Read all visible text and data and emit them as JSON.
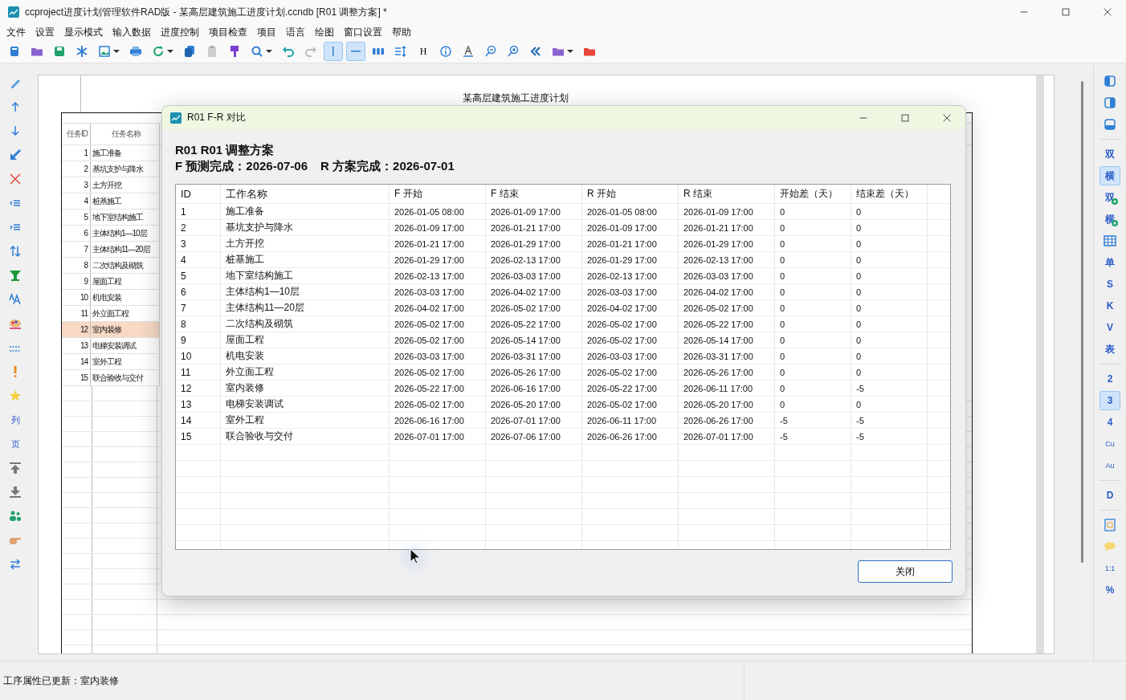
{
  "window": {
    "title": "ccproject进度计划管理软件RAD版 - 某高层建筑施工进度计划.ccndb [R01 调整方案] *"
  },
  "menu": [
    "文件",
    "设置",
    "显示模式",
    "输入数据",
    "进度控制",
    "项目检查",
    "项目",
    "语言",
    "绘图",
    "窗口设置",
    "帮助"
  ],
  "toolbar": [
    {
      "kind": "icon",
      "selected": false,
      "dropdown": false
    },
    {
      "kind": "icon",
      "selected": false,
      "dropdown": false
    },
    {
      "kind": "icon",
      "selected": false,
      "dropdown": false
    },
    {
      "kind": "icon",
      "selected": false,
      "dropdown": false
    },
    {
      "kind": "icon",
      "selected": false,
      "dropdown": true
    },
    {
      "kind": "icon",
      "selected": false,
      "dropdown": false
    },
    {
      "kind": "icon",
      "selected": false,
      "dropdown": true
    },
    {
      "kind": "icon",
      "selected": false,
      "dropdown": false
    },
    {
      "kind": "icon",
      "selected": false,
      "dropdown": false
    },
    {
      "kind": "icon",
      "selected": false,
      "dropdown": false
    },
    {
      "kind": "icon",
      "selected": false,
      "dropdown": true
    },
    {
      "kind": "icon",
      "selected": false,
      "dropdown": false
    },
    {
      "kind": "icon",
      "selected": false,
      "dropdown": false
    },
    {
      "kind": "icon",
      "selected": true,
      "dropdown": false
    },
    {
      "kind": "icon",
      "selected": true,
      "dropdown": false
    },
    {
      "kind": "icon",
      "selected": false,
      "dropdown": false
    },
    {
      "kind": "icon",
      "selected": false,
      "dropdown": false
    },
    {
      "kind": "text",
      "label": "H",
      "selected": false,
      "dropdown": false
    },
    {
      "kind": "icon",
      "selected": false,
      "dropdown": false
    },
    {
      "kind": "icon",
      "selected": false,
      "dropdown": false
    },
    {
      "kind": "icon",
      "selected": false,
      "dropdown": false
    },
    {
      "kind": "icon",
      "selected": false,
      "dropdown": false
    },
    {
      "kind": "icon",
      "selected": false,
      "dropdown": false
    },
    {
      "kind": "icon",
      "selected": false,
      "dropdown": true
    },
    {
      "kind": "icon",
      "selected": false,
      "dropdown": false
    }
  ],
  "left_toolbar": [
    {
      "kind": "icon"
    },
    {
      "kind": "icon"
    },
    {
      "kind": "icon"
    },
    {
      "kind": "icon"
    },
    {
      "kind": "icon"
    },
    {
      "kind": "icon"
    },
    {
      "kind": "icon"
    },
    {
      "kind": "icon"
    },
    {
      "kind": "icon"
    },
    {
      "kind": "icon"
    },
    {
      "kind": "icon"
    },
    {
      "kind": "icon"
    },
    {
      "kind": "icon"
    },
    {
      "kind": "icon"
    },
    {
      "kind": "text",
      "label": "列"
    },
    {
      "kind": "text",
      "label": "页"
    },
    {
      "kind": "icon"
    },
    {
      "kind": "icon"
    },
    {
      "kind": "icon"
    },
    {
      "kind": "icon"
    },
    {
      "kind": "icon"
    }
  ],
  "sheet": {
    "title": "某高层建筑施工进度计划",
    "columns": [
      "任务ID",
      "任务名称"
    ],
    "rows": [
      {
        "id": "1",
        "name": "施工准备",
        "selected": false
      },
      {
        "id": "2",
        "name": "基坑支护与降水",
        "selected": false
      },
      {
        "id": "3",
        "name": "土方开挖",
        "selected": false
      },
      {
        "id": "4",
        "name": "桩基施工",
        "selected": false
      },
      {
        "id": "5",
        "name": "地下室结构施工",
        "selected": false
      },
      {
        "id": "6",
        "name": "主体结构1—10层",
        "selected": false
      },
      {
        "id": "7",
        "name": "主体结构11—20层",
        "selected": false
      },
      {
        "id": "8",
        "name": "二次结构及砌筑",
        "selected": false
      },
      {
        "id": "9",
        "name": "屋面工程",
        "selected": false
      },
      {
        "id": "10",
        "name": "机电安装",
        "selected": false
      },
      {
        "id": "11",
        "name": "外立面工程",
        "selected": false
      },
      {
        "id": "12",
        "name": "室内装修",
        "selected": true
      },
      {
        "id": "13",
        "name": "电梯安装调试",
        "selected": false
      },
      {
        "id": "14",
        "name": "室外工程",
        "selected": false
      },
      {
        "id": "15",
        "name": "联合验收与交付",
        "selected": false
      }
    ]
  },
  "right_toolbar": {
    "groups": [
      [
        {
          "kind": "icon",
          "selected": false
        },
        {
          "kind": "icon",
          "selected": false
        },
        {
          "kind": "icon",
          "selected": false
        }
      ],
      [
        {
          "kind": "text",
          "label": "双",
          "badge": false,
          "selected": false
        },
        {
          "kind": "text",
          "label": "横",
          "badge": false,
          "selected": true
        },
        {
          "kind": "text",
          "label": "双",
          "badge": true,
          "selected": false
        },
        {
          "kind": "text",
          "label": "横",
          "badge": true,
          "selected": false
        },
        {
          "kind": "icon",
          "selected": false
        },
        {
          "kind": "text",
          "label": "单",
          "badge": false,
          "selected": false
        },
        {
          "kind": "text",
          "label": "S",
          "badge": false,
          "selected": false
        },
        {
          "kind": "text",
          "label": "K",
          "badge": false,
          "selected": false
        },
        {
          "kind": "text",
          "label": "V",
          "badge": false,
          "selected": false
        },
        {
          "kind": "text",
          "label": "表",
          "badge": false,
          "selected": false
        }
      ],
      [
        {
          "kind": "text",
          "label": "2",
          "badge": false,
          "selected": false
        },
        {
          "kind": "text",
          "label": "3",
          "badge": false,
          "selected": true
        },
        {
          "kind": "text",
          "label": "4",
          "badge": false,
          "selected": false
        },
        {
          "kind": "text",
          "label": "Cu",
          "badge": false,
          "selected": false
        },
        {
          "kind": "text",
          "label": "Au",
          "badge": false,
          "selected": false
        }
      ],
      [
        {
          "kind": "text",
          "label": "D",
          "badge": false,
          "selected": false
        }
      ],
      [
        {
          "kind": "icon",
          "selected": false
        },
        {
          "kind": "icon",
          "selected": false
        },
        {
          "kind": "text",
          "label": "1:1",
          "badge": false,
          "selected": false
        },
        {
          "kind": "text",
          "label": "%",
          "badge": false,
          "selected": false
        }
      ]
    ]
  },
  "dialog": {
    "title": "R01  F-R 对比",
    "heading": "R01  R01 调整方案",
    "summary": [
      "F 预测完成：2026-07-06",
      "R 方案完成：2026-07-01"
    ],
    "columns": [
      "ID",
      "工作名称",
      "F 开始",
      "F 结束",
      "R 开始",
      "R 结束",
      "开始差（天）",
      "结束差（天）"
    ],
    "rows": [
      [
        "1",
        "施工准备",
        "2026-01-05 08:00",
        "2026-01-09 17:00",
        "2026-01-05 08:00",
        "2026-01-09 17:00",
        "0",
        "0"
      ],
      [
        "2",
        "基坑支护与降水",
        "2026-01-09 17:00",
        "2026-01-21 17:00",
        "2026-01-09 17:00",
        "2026-01-21 17:00",
        "0",
        "0"
      ],
      [
        "3",
        "土方开挖",
        "2026-01-21 17:00",
        "2026-01-29 17:00",
        "2026-01-21 17:00",
        "2026-01-29 17:00",
        "0",
        "0"
      ],
      [
        "4",
        "桩基施工",
        "2026-01-29 17:00",
        "2026-02-13 17:00",
        "2026-01-29 17:00",
        "2026-02-13 17:00",
        "0",
        "0"
      ],
      [
        "5",
        "地下室结构施工",
        "2026-02-13 17:00",
        "2026-03-03 17:00",
        "2026-02-13 17:00",
        "2026-03-03 17:00",
        "0",
        "0"
      ],
      [
        "6",
        "主体结构1—10层",
        "2026-03-03 17:00",
        "2026-04-02 17:00",
        "2026-03-03 17:00",
        "2026-04-02 17:00",
        "0",
        "0"
      ],
      [
        "7",
        "主体结构11—20层",
        "2026-04-02 17:00",
        "2026-05-02 17:00",
        "2026-04-02 17:00",
        "2026-05-02 17:00",
        "0",
        "0"
      ],
      [
        "8",
        "二次结构及砌筑",
        "2026-05-02 17:00",
        "2026-05-22 17:00",
        "2026-05-02 17:00",
        "2026-05-22 17:00",
        "0",
        "0"
      ],
      [
        "9",
        "屋面工程",
        "2026-05-02 17:00",
        "2026-05-14 17:00",
        "2026-05-02 17:00",
        "2026-05-14 17:00",
        "0",
        "0"
      ],
      [
        "10",
        "机电安装",
        "2026-03-03 17:00",
        "2026-03-31 17:00",
        "2026-03-03 17:00",
        "2026-03-31 17:00",
        "0",
        "0"
      ],
      [
        "11",
        "外立面工程",
        "2026-05-02 17:00",
        "2026-05-26 17:00",
        "2026-05-02 17:00",
        "2026-05-26 17:00",
        "0",
        "0"
      ],
      [
        "12",
        "室内装修",
        "2026-05-22 17:00",
        "2026-06-16 17:00",
        "2026-05-22 17:00",
        "2026-06-11 17:00",
        "0",
        "-5"
      ],
      [
        "13",
        "电梯安装调试",
        "2026-05-02 17:00",
        "2026-05-20 17:00",
        "2026-05-02 17:00",
        "2026-05-20 17:00",
        "0",
        "0"
      ],
      [
        "14",
        "室外工程",
        "2026-06-16 17:00",
        "2026-07-01 17:00",
        "2026-06-11 17:00",
        "2026-06-26 17:00",
        "-5",
        "-5"
      ],
      [
        "15",
        "联合验收与交付",
        "2026-07-01 17:00",
        "2026-07-06 17:00",
        "2026-06-26 17:00",
        "2026-07-01 17:00",
        "-5",
        "-5"
      ]
    ],
    "close_button": "关闭"
  },
  "status_bar": {
    "message": "工序属性已更新：室内装修"
  }
}
